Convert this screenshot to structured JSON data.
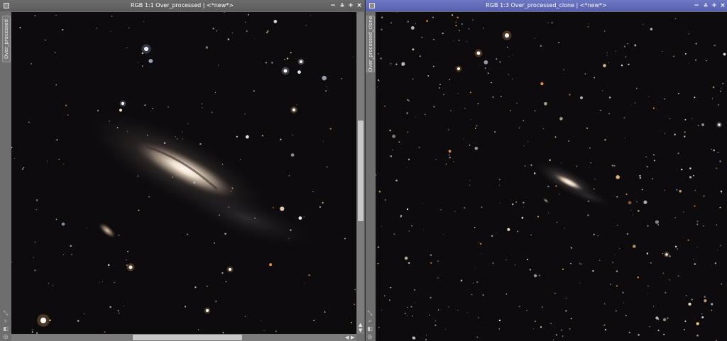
{
  "windows": [
    {
      "title": "RGB 1:1 Over_processed | <*new*>",
      "side_tab": "Over_processed",
      "buttons": {
        "shade": "−",
        "restore": "⩮",
        "maximize": "+",
        "close": "×"
      }
    },
    {
      "title": "RGB 1:3 Over_processed_clone | <*new*>",
      "side_tab": "Over_processed_clone",
      "buttons": {
        "shade": "−",
        "restore": "⩮",
        "maximize": "+",
        "close": "×"
      }
    }
  ],
  "icons": [
    "window-menu-icon",
    "shade-icon",
    "restore-icon",
    "maximize-icon",
    "close-icon",
    "scroll-up-arrow-icon",
    "scroll-down-arrow-icon",
    "scroll-left-arrow-icon",
    "scroll-right-arrow-icon"
  ],
  "colors": {
    "active_titlebar": "#5661b0",
    "inactive_titlebar": "#5c5c5c",
    "canvas_background": "#0d0b0d"
  }
}
